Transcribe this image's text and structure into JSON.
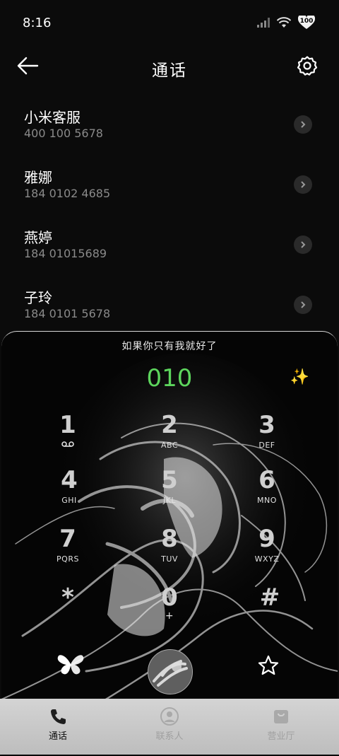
{
  "status": {
    "time": "8:16",
    "battery": "100"
  },
  "header": {
    "title": "通话"
  },
  "contacts": [
    {
      "name": "小米客服",
      "number": "400 100 5678"
    },
    {
      "name": "雅娜",
      "number": "184 0102 4685"
    },
    {
      "name": "燕婷",
      "number": "184 01015689"
    },
    {
      "name": "子玲",
      "number": "184 0101 5678"
    }
  ],
  "dialer": {
    "song_title": "如果你只有我就好了",
    "dialed_number": "010",
    "number_color": "#5dd55d",
    "keys": [
      {
        "digit": "1",
        "letters": "voicemail-icon"
      },
      {
        "digit": "2",
        "letters": "ABC"
      },
      {
        "digit": "3",
        "letters": "DEF"
      },
      {
        "digit": "4",
        "letters": "GHI"
      },
      {
        "digit": "5",
        "letters": "JKL"
      },
      {
        "digit": "6",
        "letters": "MNO"
      },
      {
        "digit": "7",
        "letters": "PQRS"
      },
      {
        "digit": "8",
        "letters": "TUV"
      },
      {
        "digit": "9",
        "letters": "WXYZ"
      },
      {
        "digit": "*",
        "letters": ""
      },
      {
        "digit": "0",
        "letters": "+"
      },
      {
        "digit": "#",
        "letters": ""
      }
    ]
  },
  "tabs": [
    {
      "label": "通话",
      "icon": "phone-icon",
      "active": true
    },
    {
      "label": "联系人",
      "icon": "person-icon",
      "active": false
    },
    {
      "label": "营业厅",
      "icon": "bag-icon",
      "active": false
    }
  ]
}
